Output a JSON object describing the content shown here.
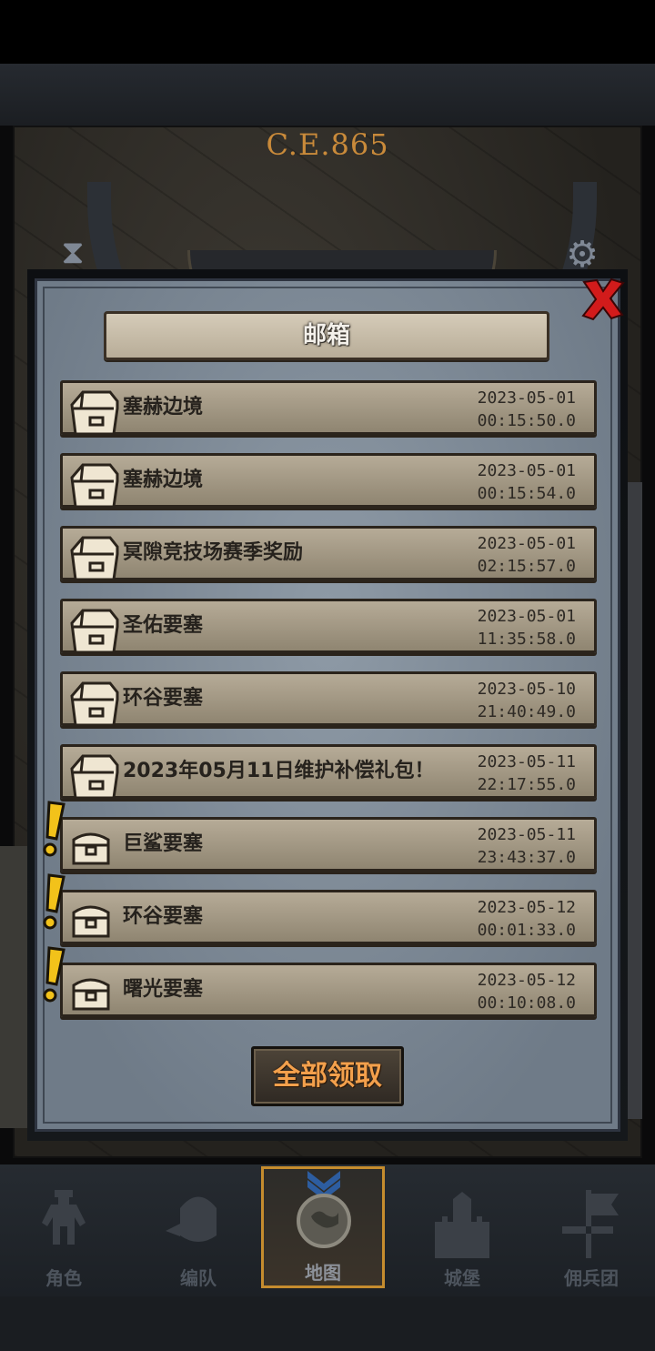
{
  "header": {
    "era": "C.E.865"
  },
  "mailbox": {
    "title": "邮箱",
    "items": [
      {
        "title": "塞赫边境",
        "date": "2023-05-01",
        "time": "00:15:50.0",
        "unread": false
      },
      {
        "title": "塞赫边境",
        "date": "2023-05-01",
        "time": "00:15:54.0",
        "unread": false
      },
      {
        "title": "冥隙竞技场赛季奖励",
        "date": "2023-05-01",
        "time": "02:15:57.0",
        "unread": false
      },
      {
        "title": "圣佑要塞",
        "date": "2023-05-01",
        "time": "11:35:58.0",
        "unread": false
      },
      {
        "title": "环谷要塞",
        "date": "2023-05-10",
        "time": "21:40:49.0",
        "unread": false
      },
      {
        "title": "2023年05月11日维护补偿礼包！",
        "date": "2023-05-11",
        "time": "22:17:55.0",
        "unread": false
      },
      {
        "title": "巨鲨要塞",
        "date": "2023-05-11",
        "time": "23:43:37.0",
        "unread": true
      },
      {
        "title": "环谷要塞",
        "date": "2023-05-12",
        "time": "00:01:33.0",
        "unread": true
      },
      {
        "title": "曙光要塞",
        "date": "2023-05-12",
        "time": "00:10:08.0",
        "unread": true
      }
    ],
    "claim_all_label": "全部领取"
  },
  "nav": {
    "tabs": [
      {
        "label": "角色",
        "icon": "knight-icon"
      },
      {
        "label": "编队",
        "icon": "helmet-icon"
      },
      {
        "label": "地图",
        "icon": "map-globe-icon",
        "active": true
      },
      {
        "label": "城堡",
        "icon": "castle-icon"
      },
      {
        "label": "佣兵团",
        "icon": "mercenary-banner-icon"
      }
    ]
  },
  "colors": {
    "accent_orange": "#f3a04c",
    "alert_yellow": "#f2c21a",
    "close_red": "#d21b1b",
    "active_tab_border": "#c58c2e"
  }
}
